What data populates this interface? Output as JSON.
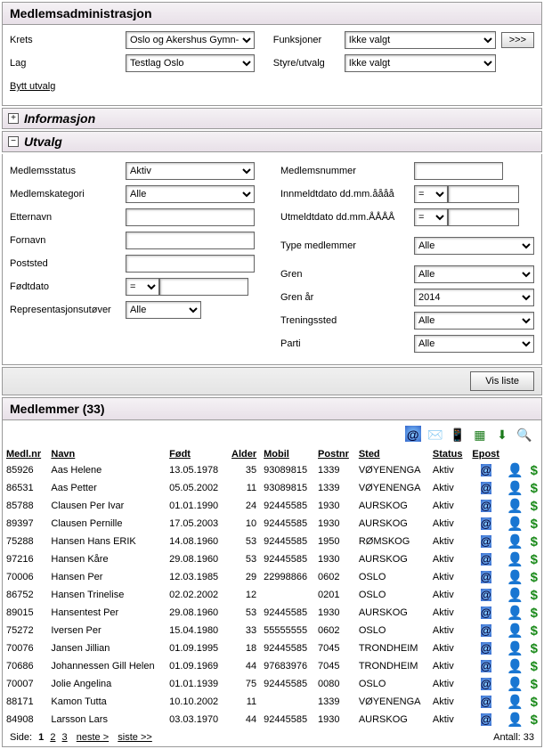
{
  "admin": {
    "title": "Medlemsadministrasjon",
    "krets_label": "Krets",
    "krets_value": "Oslo og Akershus Gymn- o",
    "lag_label": "Lag",
    "lag_value": "Testlag Oslo",
    "bytt_utvalg": "Bytt utvalg",
    "funksjoner_label": "Funksjoner",
    "funksjoner_value": "Ikke valgt",
    "styre_label": "Styre/utvalg",
    "styre_value": "Ikke valgt",
    "go_btn": ">>>"
  },
  "info": {
    "title": "Informasjon"
  },
  "utvalg": {
    "title": "Utvalg",
    "medlemsstatus_label": "Medlemsstatus",
    "medlemsstatus_value": "Aktiv",
    "medlemskategori_label": "Medlemskategori",
    "medlemskategori_value": "Alle",
    "etternavn_label": "Etternavn",
    "fornavn_label": "Fornavn",
    "poststed_label": "Poststed",
    "fodtdato_label": "Fødtdato",
    "fodtdato_op": "=",
    "repr_label": "Representasjonsutøver",
    "repr_value": "Alle",
    "medlemsnummer_label": "Medlemsnummer",
    "innmeldt_label": "Innmeldtdato dd.mm.åååå",
    "innmeldt_op": "=",
    "utmeldt_label": "Utmeldtdato dd.mm.ÅÅÅÅ",
    "utmeldt_op": "=",
    "type_label": "Type medlemmer",
    "type_value": "Alle",
    "gren_label": "Gren",
    "gren_value": "Alle",
    "grenaar_label": "Gren år",
    "grenaar_value": "2014",
    "treningssted_label": "Treningssted",
    "treningssted_value": "Alle",
    "parti_label": "Parti",
    "parti_value": "Alle",
    "visliste_btn": "Vis liste"
  },
  "members": {
    "title": "Medlemmer  (33)",
    "headers": {
      "medlnr": "Medl.nr",
      "navn": "Navn",
      "fodt": "Født",
      "alder": "Alder",
      "mobil": "Mobil",
      "postnr": "Postnr",
      "sted": "Sted",
      "status": "Status",
      "epost": "Epost"
    },
    "rows": [
      {
        "nr": "85926",
        "navn": "Aas Helene",
        "fodt": "13.05.1978",
        "alder": "35",
        "mobil": "93089815",
        "postnr": "1339",
        "sted": "VØYENENGA",
        "status": "Aktiv"
      },
      {
        "nr": "86531",
        "navn": "Aas Petter",
        "fodt": "05.05.2002",
        "alder": "11",
        "mobil": "93089815",
        "postnr": "1339",
        "sted": "VØYENENGA",
        "status": "Aktiv"
      },
      {
        "nr": "85788",
        "navn": "Clausen Per Ivar",
        "fodt": "01.01.1990",
        "alder": "24",
        "mobil": "92445585",
        "postnr": "1930",
        "sted": "AURSKOG",
        "status": "Aktiv"
      },
      {
        "nr": "89397",
        "navn": "Clausen Pernille",
        "fodt": "17.05.2003",
        "alder": "10",
        "mobil": "92445585",
        "postnr": "1930",
        "sted": "AURSKOG",
        "status": "Aktiv"
      },
      {
        "nr": "75288",
        "navn": "Hansen Hans ERIK",
        "fodt": "14.08.1960",
        "alder": "53",
        "mobil": "92445585",
        "postnr": "1950",
        "sted": "RØMSKOG",
        "status": "Aktiv"
      },
      {
        "nr": "97216",
        "navn": "Hansen Kåre",
        "fodt": "29.08.1960",
        "alder": "53",
        "mobil": "92445585",
        "postnr": "1930",
        "sted": "AURSKOG",
        "status": "Aktiv"
      },
      {
        "nr": "70006",
        "navn": "Hansen Per",
        "fodt": "12.03.1985",
        "alder": "29",
        "mobil": "22998866",
        "postnr": "0602",
        "sted": "OSLO",
        "status": "Aktiv"
      },
      {
        "nr": "86752",
        "navn": "Hansen Trinelise",
        "fodt": "02.02.2002",
        "alder": "12",
        "mobil": "",
        "postnr": "0201",
        "sted": "OSLO",
        "status": "Aktiv"
      },
      {
        "nr": "89015",
        "navn": "Hansentest Per",
        "fodt": "29.08.1960",
        "alder": "53",
        "mobil": "92445585",
        "postnr": "1930",
        "sted": "AURSKOG",
        "status": "Aktiv"
      },
      {
        "nr": "75272",
        "navn": "Iversen Per",
        "fodt": "15.04.1980",
        "alder": "33",
        "mobil": "55555555",
        "postnr": "0602",
        "sted": "OSLO",
        "status": "Aktiv"
      },
      {
        "nr": "70076",
        "navn": "Jansen Jillian",
        "fodt": "01.09.1995",
        "alder": "18",
        "mobil": "92445585",
        "postnr": "7045",
        "sted": "TRONDHEIM",
        "status": "Aktiv"
      },
      {
        "nr": "70686",
        "navn": "Johannessen Gill Helen",
        "fodt": "01.09.1969",
        "alder": "44",
        "mobil": "97683976",
        "postnr": "7045",
        "sted": "TRONDHEIM",
        "status": "Aktiv"
      },
      {
        "nr": "70007",
        "navn": "Jolie Angelina",
        "fodt": "01.01.1939",
        "alder": "75",
        "mobil": "92445585",
        "postnr": "0080",
        "sted": "OSLO",
        "status": "Aktiv"
      },
      {
        "nr": "88171",
        "navn": "Kamon Tutta",
        "fodt": "10.10.2002",
        "alder": "11",
        "mobil": "",
        "postnr": "1339",
        "sted": "VØYENENGA",
        "status": "Aktiv"
      },
      {
        "nr": "84908",
        "navn": "Larsson Lars",
        "fodt": "03.03.1970",
        "alder": "44",
        "mobil": "92445585",
        "postnr": "1930",
        "sted": "AURSKOG",
        "status": "Aktiv"
      }
    ],
    "pager": {
      "side_label": "Side:",
      "pages": [
        "1",
        "2",
        "3"
      ],
      "current": "1",
      "neste": "neste >",
      "siste": "siste >>",
      "antall_label": "Antall: 33"
    }
  }
}
